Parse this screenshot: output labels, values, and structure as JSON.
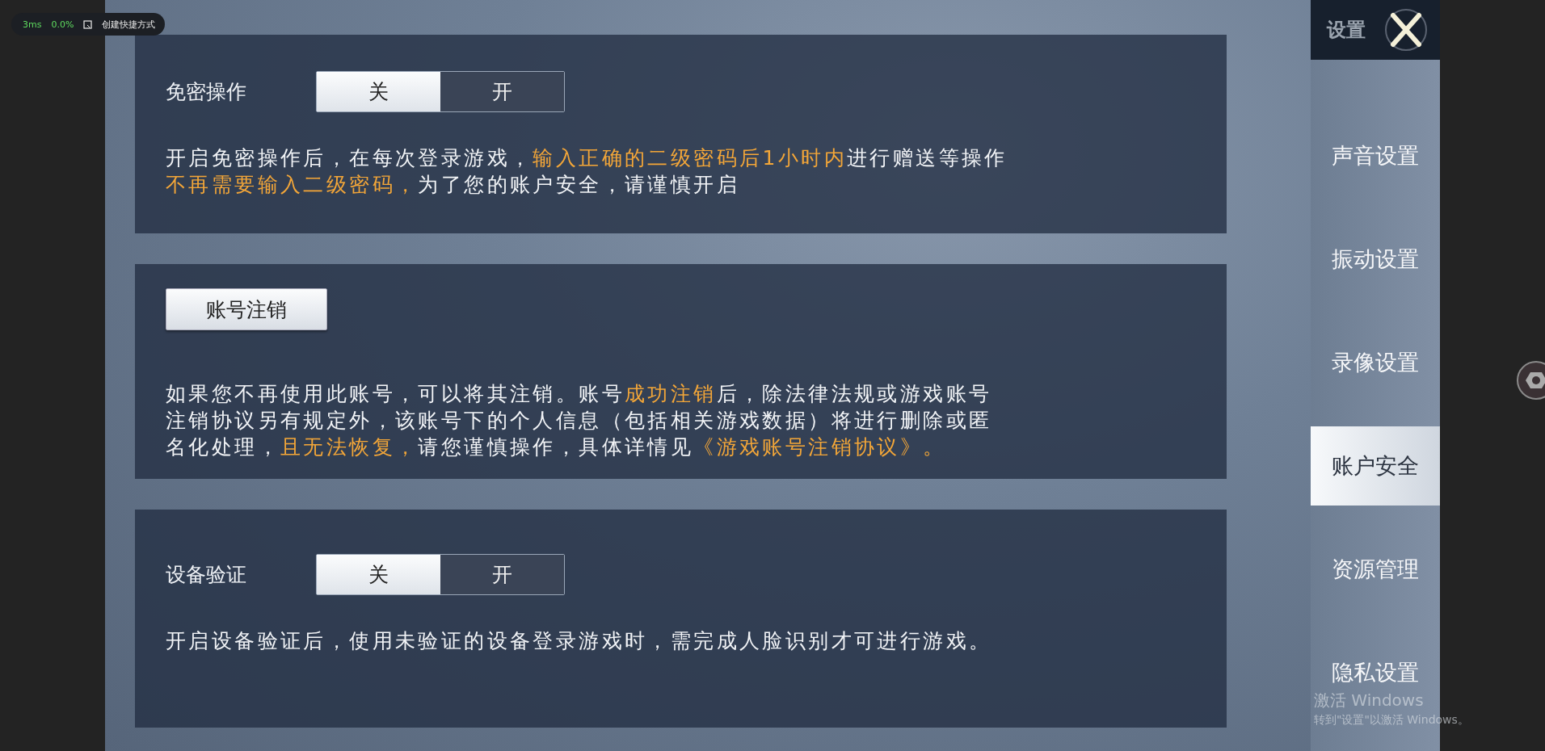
{
  "overlay": {
    "latency": "3ms",
    "cpu": "0.0%",
    "shortcut": "创建快捷方式"
  },
  "sections": [
    {
      "kind": "toggle",
      "label": "免密操作",
      "options": [
        {
          "label": "关",
          "selected": true
        },
        {
          "label": "开",
          "selected": false
        }
      ],
      "description": [
        {
          "text": "开启免密操作后，在每次登录游戏，",
          "highlight": false
        },
        {
          "text": "输入正确的二级密码后1小时内",
          "highlight": true
        },
        {
          "text": "进行赠送等操作",
          "highlight": false
        },
        {
          "text": "不再需要输入二级密码，",
          "highlight": true
        },
        {
          "text": "为了您的账户安全，请谨慎开启",
          "highlight": false
        }
      ]
    },
    {
      "kind": "button",
      "label": "账号注销",
      "description": [
        {
          "text": "如果您不再使用此账号，可以将其注销。账号",
          "highlight": false
        },
        {
          "text": "成功注销",
          "highlight": true
        },
        {
          "text": "后，除法律法规或游戏账号注销协议另有规定外，该账号下的个人信息（包括相关游戏数据）将进行删除或匿名化处理，",
          "highlight": false
        },
        {
          "text": "且无法恢复，",
          "highlight": true
        },
        {
          "text": "请您谨慎操作，具体详情见",
          "highlight": false
        },
        {
          "text": "《游戏账号注销协议》。",
          "highlight": true
        }
      ]
    },
    {
      "kind": "toggle",
      "label": "设备验证",
      "options": [
        {
          "label": "关",
          "selected": true
        },
        {
          "label": "开",
          "selected": false
        }
      ],
      "description": [
        {
          "text": "开启设备验证后，使用未验证的设备登录游戏时，需完成人脸识别才可进行游戏。",
          "highlight": false
        }
      ]
    }
  ],
  "sidebar": {
    "title": "设置",
    "items": [
      {
        "label": "声音设置",
        "selected": false
      },
      {
        "label": "振动设置",
        "selected": false
      },
      {
        "label": "录像设置",
        "selected": false
      },
      {
        "label": "账户安全",
        "selected": true
      },
      {
        "label": "资源管理",
        "selected": false
      },
      {
        "label": "隐私设置",
        "selected": false
      }
    ]
  },
  "watermark": {
    "title": "激活 Windows",
    "subtitle": "转到\"设置\"以激活 Windows。"
  }
}
